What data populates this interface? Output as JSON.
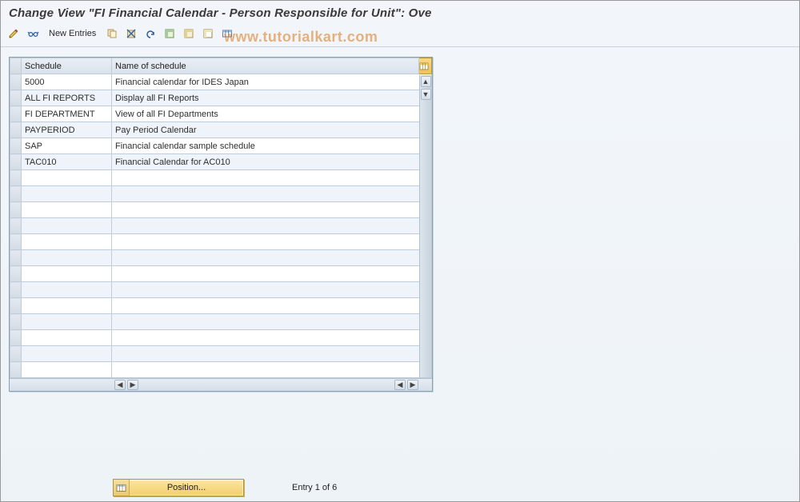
{
  "window": {
    "title": "Change View \"FI Financial Calendar - Person Responsible for Unit\": Ove"
  },
  "toolbar": {
    "new_entries_label": "New Entries"
  },
  "watermark": "www.tutorialkart.com",
  "table": {
    "headers": {
      "schedule": "Schedule",
      "name": "Name of schedule"
    },
    "rows": [
      {
        "schedule": "5000",
        "name": "Financial calendar for IDES Japan"
      },
      {
        "schedule": "ALL FI REPORTS",
        "name": "Display all FI Reports"
      },
      {
        "schedule": "FI DEPARTMENT",
        "name": "View of all FI Departments"
      },
      {
        "schedule": "PAYPERIOD",
        "name": "Pay Period Calendar"
      },
      {
        "schedule": "SAP",
        "name": "Financial calendar sample schedule"
      },
      {
        "schedule": "TAC010",
        "name": "Financial Calendar for AC010"
      },
      {
        "schedule": "",
        "name": ""
      },
      {
        "schedule": "",
        "name": ""
      },
      {
        "schedule": "",
        "name": ""
      },
      {
        "schedule": "",
        "name": ""
      },
      {
        "schedule": "",
        "name": ""
      },
      {
        "schedule": "",
        "name": ""
      },
      {
        "schedule": "",
        "name": ""
      },
      {
        "schedule": "",
        "name": ""
      },
      {
        "schedule": "",
        "name": ""
      },
      {
        "schedule": "",
        "name": ""
      },
      {
        "schedule": "",
        "name": ""
      },
      {
        "schedule": "",
        "name": ""
      },
      {
        "schedule": "",
        "name": ""
      }
    ]
  },
  "footer": {
    "position_label": "Position...",
    "entry_text": "Entry 1 of 6"
  },
  "icons": {
    "pencil": "pencil-icon",
    "glasses": "glasses-icon",
    "copy": "copy-icon",
    "delete": "delete-icon",
    "undo": "undo-icon",
    "select_all": "select-all-icon",
    "select_block": "select-block-icon",
    "deselect": "deselect-icon",
    "table_settings": "table-settings-icon",
    "position": "position-icon"
  },
  "colors": {
    "accent_yellow": "#f4cf6a",
    "header_bg": "#d8e2ec",
    "border": "#8aa0b8"
  }
}
